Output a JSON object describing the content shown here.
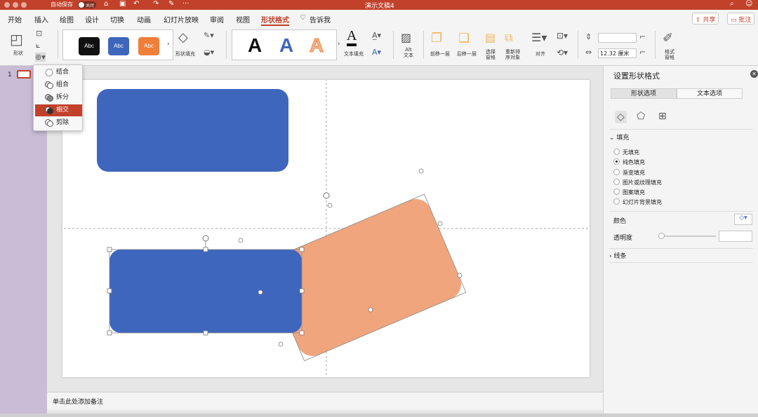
{
  "titlebar": {
    "autosave_label": "自动保存",
    "autosave_state": "关闭",
    "doc_title": "演示文稿4"
  },
  "tabs": [
    "开始",
    "插入",
    "绘图",
    "设计",
    "切换",
    "动画",
    "幻灯片放映",
    "审阅",
    "视图",
    "形状格式"
  ],
  "active_tab": "形状格式",
  "tell_me": "告诉我",
  "share_label": "共享",
  "comment_label": "批注",
  "ribbon": {
    "shape_label": "形状",
    "swatch_text": "Abc",
    "shape_fill_label": "形状填充",
    "wordart_letter": "A",
    "text_fill_label": "文本填充",
    "alt_text_label": "Alt\n文本",
    "bring_forward": "前移一层",
    "send_backward": "后移一层",
    "selection_pane": "选择\n窗格",
    "reorder": "重新排\n序对象",
    "align": "对齐",
    "width_value": "12.32 厘米",
    "format_pane": "格式\n窗格",
    "colors": {
      "black": "#111111",
      "blue": "#3f66bd",
      "orange": "#ef7f3a"
    }
  },
  "merge_menu": {
    "items": [
      "结合",
      "组合",
      "拆分",
      "相交",
      "剪除"
    ],
    "selected": "相交"
  },
  "thumbnails": {
    "slide_number": "1"
  },
  "notes_placeholder": "单击此处添加备注",
  "format_pane": {
    "title": "设置形状格式",
    "tabs": [
      "形状选项",
      "文本选项"
    ],
    "fill_section": "填充",
    "fill_options": [
      "无填充",
      "纯色填充",
      "渐变填充",
      "图片或纹理填充",
      "图案填充",
      "幻灯片背景填充"
    ],
    "selected_fill": "纯色填充",
    "color_label": "颜色",
    "transparency_label": "透明度",
    "line_section": "线条"
  },
  "slide_colors": {
    "blue": "#3f66bd",
    "orange": "#f0a57c",
    "overlap": "#a06a63"
  }
}
